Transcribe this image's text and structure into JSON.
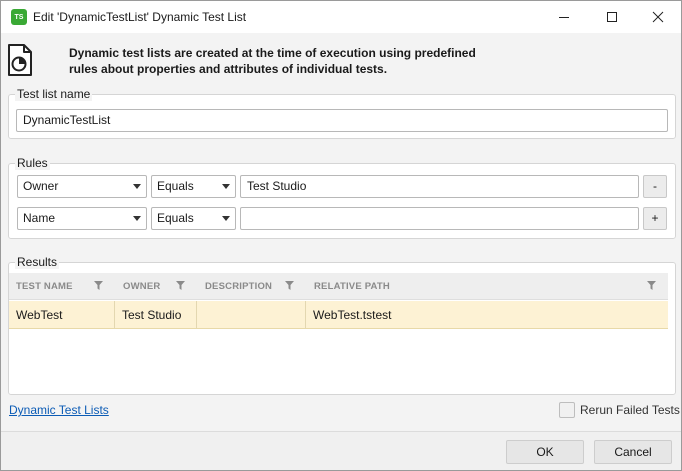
{
  "window": {
    "icon_text": "TS",
    "title": "Edit 'DynamicTestList' Dynamic Test List"
  },
  "header": {
    "description_line1": "Dynamic test lists are created at the time of execution using predefined",
    "description_line2": "rules about properties and attributes of individual tests."
  },
  "test_list_name": {
    "legend": "Test list name",
    "value": "DynamicTestList"
  },
  "rules": {
    "legend": "Rules",
    "rows": [
      {
        "property": "Owner",
        "operator": "Equals",
        "value": "Test Studio",
        "action": "-"
      },
      {
        "property": "Name",
        "operator": "Equals",
        "value": "",
        "action": "+"
      }
    ]
  },
  "results": {
    "legend": "Results",
    "columns": [
      "TEST NAME",
      "OWNER",
      "DESCRIPTION",
      "RELATIVE PATH"
    ],
    "rows": [
      {
        "test_name": "WebTest",
        "owner": "Test Studio",
        "description": "",
        "relative_path": "WebTest.tstest"
      }
    ]
  },
  "footer_links": {
    "dynamic_test_lists": "Dynamic Test Lists"
  },
  "options": {
    "rerun_failed_label": "Rerun Failed Tests",
    "rerun_failed_checked": false
  },
  "buttons": {
    "ok": "OK",
    "cancel": "Cancel"
  },
  "colors": {
    "accent_green": "#3aa935",
    "selected_row": "#fdf2d4",
    "link": "#0b5bb5"
  }
}
